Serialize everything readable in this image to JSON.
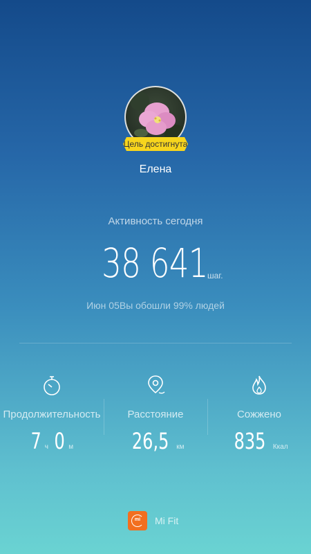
{
  "profile": {
    "name": "Елена",
    "goal_badge": "Цель достигнута"
  },
  "activity": {
    "label": "Активность сегодня",
    "steps": "38 641",
    "steps_unit": "шаг.",
    "date": "Июн 05",
    "comparison": "Вы обошли 99% людей"
  },
  "stats": {
    "duration": {
      "label": "Продолжительность",
      "hours": "7",
      "hours_unit": "ч",
      "minutes": "0",
      "minutes_unit": "м",
      "icon": "stopwatch-icon"
    },
    "distance": {
      "label": "Расстояние",
      "value": "26,5",
      "unit": "км",
      "icon": "location-pin-icon"
    },
    "calories": {
      "label": "Сожжено",
      "value": "835",
      "unit": "Ккал",
      "icon": "flame-icon"
    }
  },
  "footer": {
    "logo_text": "mi",
    "app_name": "Mi Fit"
  },
  "colors": {
    "gradient_top": "#144a8a",
    "gradient_bottom": "#6ad3d2",
    "badge": "#f7d51d",
    "logo": "#f26f1f"
  }
}
